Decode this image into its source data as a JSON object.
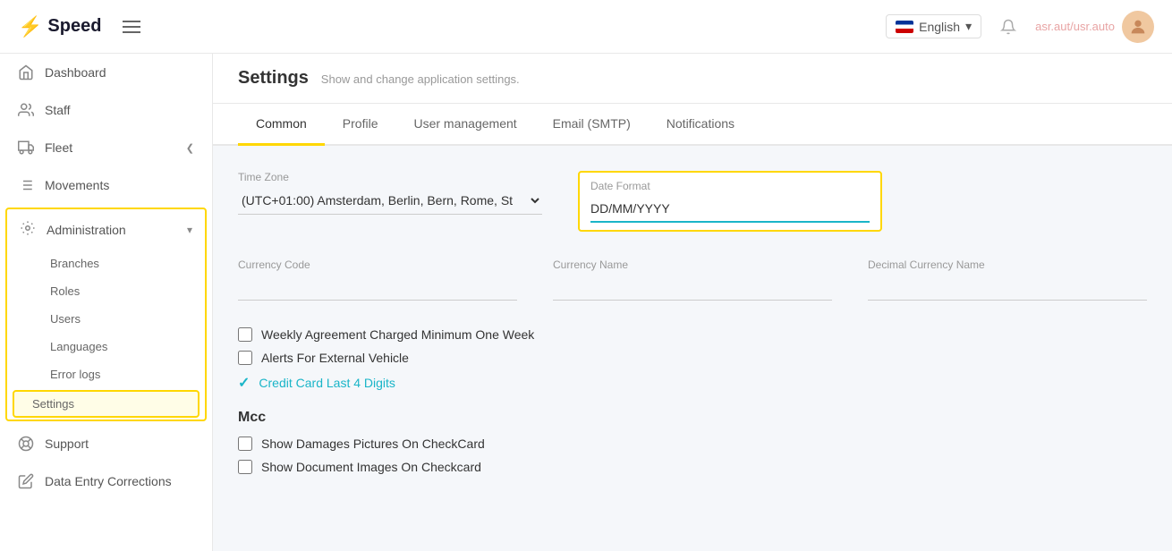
{
  "app": {
    "logo_text": "Speed",
    "logo_symbol": "⚡"
  },
  "header": {
    "language": "English",
    "language_dropdown": "▾",
    "notification_icon": "bell",
    "user_name": "asr.aut/usr.auto",
    "avatar_icon": "👤"
  },
  "sidebar": {
    "items": [
      {
        "id": "dashboard",
        "label": "Dashboard",
        "icon": "home"
      },
      {
        "id": "staff",
        "label": "Staff",
        "icon": "staff"
      },
      {
        "id": "fleet",
        "label": "Fleet",
        "icon": "fleet",
        "has_arrow": true
      },
      {
        "id": "movements",
        "label": "Movements",
        "icon": "movements"
      },
      {
        "id": "administration",
        "label": "Administration",
        "icon": "settings",
        "expanded": true
      },
      {
        "id": "support",
        "label": "Support",
        "icon": "support"
      },
      {
        "id": "data-entry",
        "label": "Data Entry Corrections",
        "icon": "data-entry"
      }
    ],
    "admin_sub_items": [
      {
        "id": "branches",
        "label": "Branches"
      },
      {
        "id": "roles",
        "label": "Roles"
      },
      {
        "id": "users",
        "label": "Users"
      },
      {
        "id": "languages",
        "label": "Languages"
      },
      {
        "id": "error-logs",
        "label": "Error logs"
      },
      {
        "id": "settings",
        "label": "Settings",
        "active": true
      }
    ]
  },
  "page": {
    "title": "Settings",
    "subtitle": "Show and change application settings."
  },
  "tabs": [
    {
      "id": "common",
      "label": "Common",
      "active": true
    },
    {
      "id": "profile",
      "label": "Profile"
    },
    {
      "id": "user-management",
      "label": "User management"
    },
    {
      "id": "email-smtp",
      "label": "Email (SMTP)"
    },
    {
      "id": "notifications",
      "label": "Notifications"
    }
  ],
  "form": {
    "timezone_label": "Time Zone",
    "timezone_value": "(UTC+01:00) Amsterdam, Berlin, Bern, Rome, St ▾",
    "date_format_label": "Date Format",
    "date_format_value": "DD/MM/YYYY",
    "currency_code_label": "Currency Code",
    "currency_code_value": "",
    "currency_name_label": "Currency Name",
    "currency_name_value": "",
    "decimal_currency_name_label": "Decimal Currency Name",
    "decimal_currency_name_value": ""
  },
  "checkboxes": [
    {
      "id": "weekly-agreement",
      "label": "Weekly Agreement Charged Minimum One Week",
      "checked": false
    },
    {
      "id": "alerts-external",
      "label": "Alerts For External Vehicle",
      "checked": false
    },
    {
      "id": "credit-card",
      "label": "Credit Card Last 4 Digits",
      "checked": true,
      "blue_check": true
    }
  ],
  "mcc_section": {
    "heading": "Mcc",
    "checkboxes": [
      {
        "id": "show-damages",
        "label": "Show Damages Pictures On CheckCard",
        "checked": false
      },
      {
        "id": "show-documents",
        "label": "Show Document Images On Checkcard",
        "checked": false
      }
    ]
  }
}
